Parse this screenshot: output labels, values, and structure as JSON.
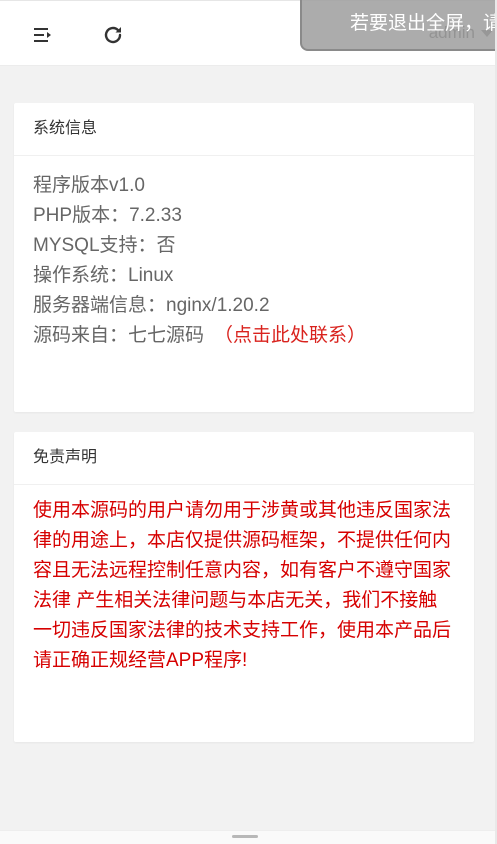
{
  "header": {
    "menu_icon": "indent-menu-icon",
    "refresh_icon": "refresh-icon",
    "user_name": "admin"
  },
  "toast": {
    "text": "若要退出全屏，请"
  },
  "system_info": {
    "title": "系统信息",
    "lines": [
      "程序版本v1.0",
      "PHP版本：7.2.33",
      "MYSQL支持：否",
      "操作系统：Linux",
      "服务器端信息：nginx/1.20.2",
      "源码来自：七七源码"
    ],
    "contact_link": "（点击此处联系）"
  },
  "disclaimer": {
    "title": "免责声明",
    "text": "使用本源码的用户请勿用于涉黄或其他违反国家法律的用途上，本店仅提供源码框架，不提供任何内容且无法远程控制任意内容，如有客户不遵守国家法律 产生相关法律问题与本店无关，我们不接触一切违反国家法律的技术支持工作，使用本产品后请正确正规经营APP程序!"
  },
  "colors": {
    "notice_red": "#d60000",
    "link_red": "#d9231e",
    "background": "#f2f2f2"
  }
}
